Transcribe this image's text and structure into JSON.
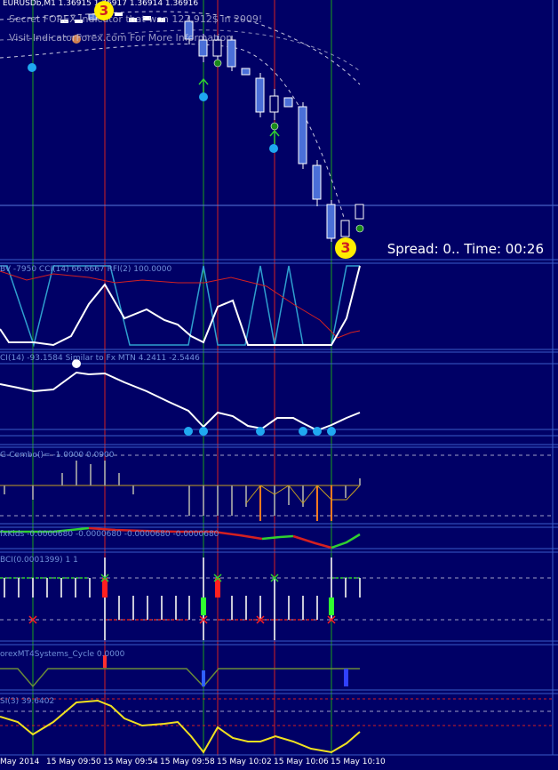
{
  "chart": {
    "symbol_line": "EURUSDb,M1  1.36915  1.36917  1.36914  1.36916",
    "overlay_line1": "Secret FOREX Indicator that won 127,912$ in 2009!",
    "overlay_line2": "Visit IndicatorForex.com For More Information",
    "spread_time": "Spread: 0.. Time: 00:26",
    "marker_digit": "3"
  },
  "panels": [
    {
      "label": "BV -7950  CCI(14) 66.6667  RFI(2) 100.0000"
    },
    {
      "label": "CI(14) -93.1584   Similar to Fx MTN  4.2411  -2.5446"
    },
    {
      "label": "G-Combo()= -1.0000 0.0900"
    },
    {
      "label": "fxKids -0.0000680 -0.0000680 -0.0000680 -0.0000680"
    },
    {
      "label": "BCI(0.0001399) 1 1"
    },
    {
      "label": "orexMT4Systems_Cycle 0.0000"
    },
    {
      "label": "SI(3) 39.6402"
    }
  ],
  "time_axis": [
    "May 2014",
    "15 May 09:50",
    "15 May 09:54",
    "15 May 09:58",
    "15 May 10:02",
    "15 May 10:06",
    "15 May 10:10"
  ],
  "colors": {
    "background": "#000066",
    "bull_candle": "#ffffff",
    "bear_candle": "#4a6fd8",
    "separator": "#3a5cc8",
    "vline_green": "#1aa01a",
    "vline_red": "#d42020",
    "zigzag": "#2f9fcf",
    "white_line": "#ffffff",
    "red_line": "#d42020",
    "yellow_line": "#f0e020",
    "dot": "#1fa8f0",
    "marker": "#ffee00"
  }
}
